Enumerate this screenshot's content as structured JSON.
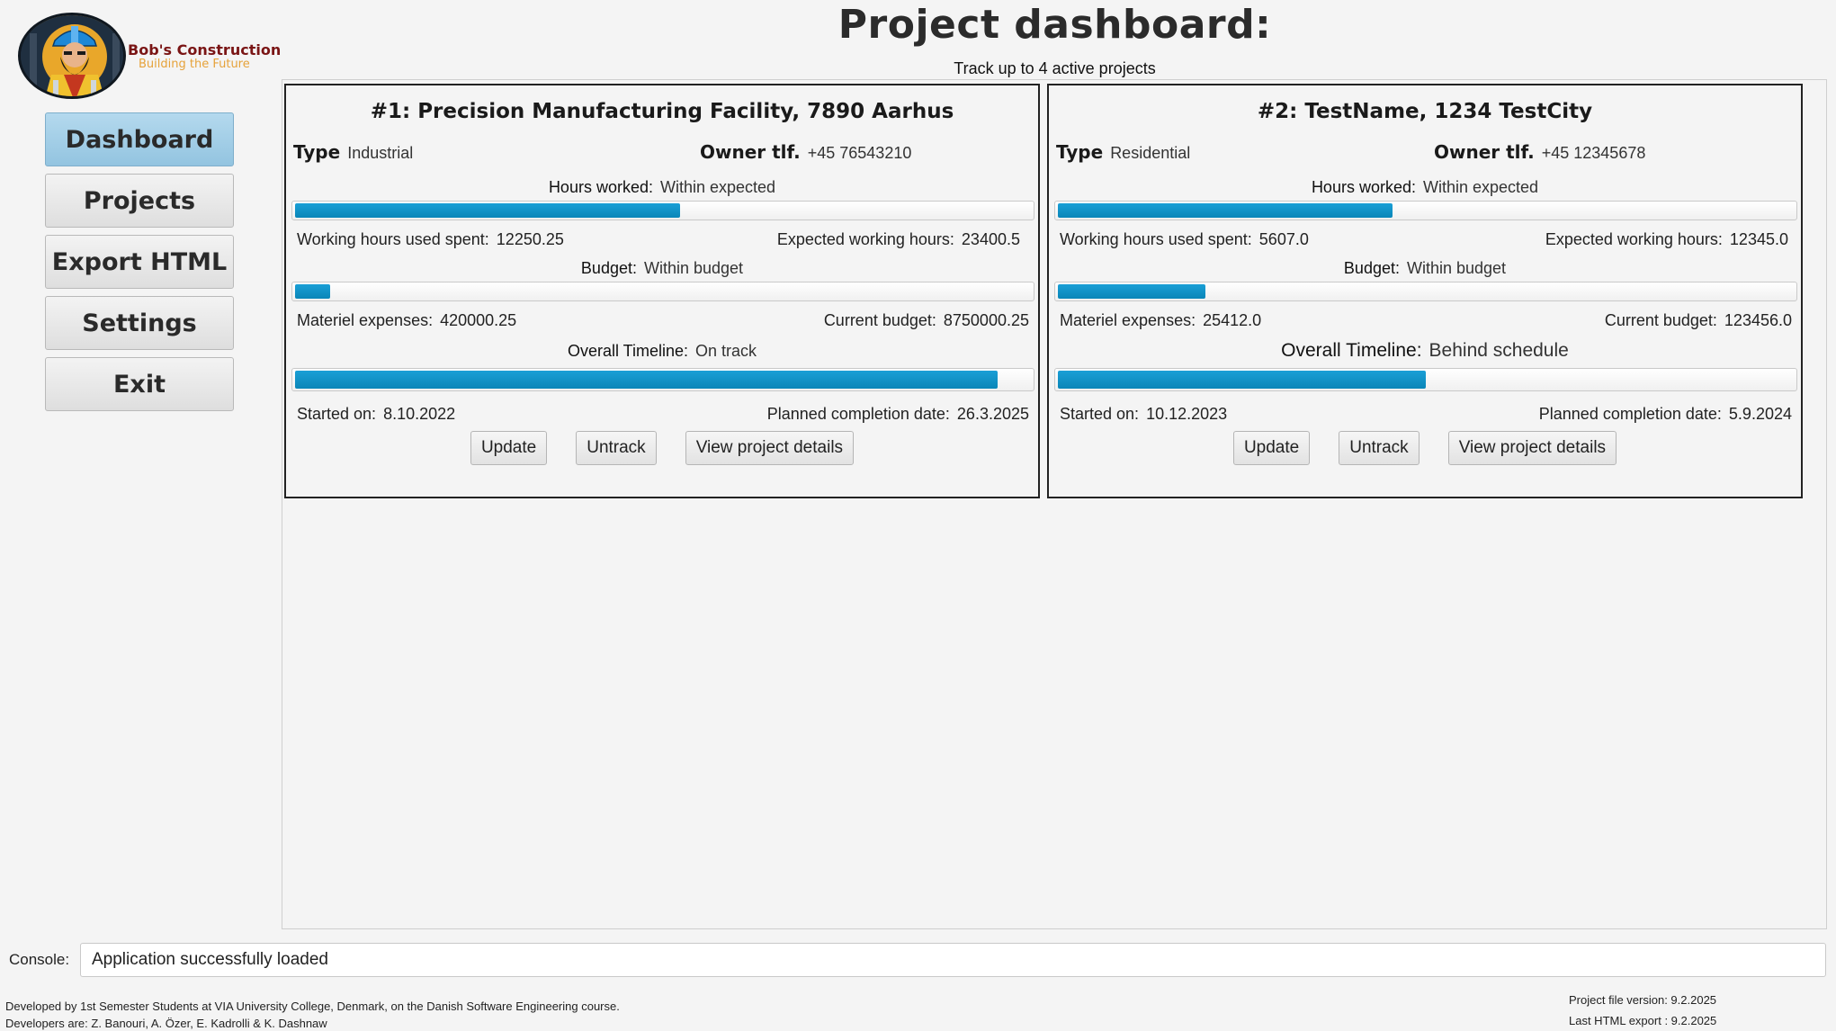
{
  "brand": {
    "name": "Bob's Construction",
    "tagline": "Building the Future",
    "colors": {
      "name": "#7a1515",
      "tagline": "#e6a23a",
      "accent": "#0a86b8"
    }
  },
  "sidebar": {
    "items": [
      {
        "label": "Dashboard",
        "active": true
      },
      {
        "label": "Projects",
        "active": false
      },
      {
        "label": "Export HTML",
        "active": false
      },
      {
        "label": "Settings",
        "active": false
      },
      {
        "label": "Exit",
        "active": false
      }
    ]
  },
  "header": {
    "title": "Project dashboard:",
    "subtitle": "Track up to 4 active projects"
  },
  "projects": [
    {
      "title": "#1: Precision Manufacturing Facility, 7890 Aarhus",
      "type_label": "Type",
      "type": "Industrial",
      "owner_label": "Owner tlf.",
      "owner_phone": "+45 76543210",
      "hours_label": "Hours worked:",
      "hours_status": "Within expected",
      "hours_progress": 0.5235,
      "hours_used_label": "Working hours used spent:",
      "hours_used": "12250.25",
      "hours_expected_label": "Expected working hours:",
      "hours_expected": "23400.5",
      "budget_label": "Budget:",
      "budget_status": "Within budget",
      "budget_progress": 0.048,
      "expenses_label": "Materiel expenses:",
      "expenses": "420000.25",
      "current_budget_label": "Current budget:",
      "current_budget": "8750000.25",
      "timeline_label": "Overall Timeline:",
      "timeline_status": "On track",
      "timeline_progress": 0.955,
      "started_label": "Started on:",
      "started": "8.10.2022",
      "planned_label": "Planned completion date:",
      "planned": "26.3.2025",
      "buttons": {
        "update": "Update",
        "untrack": "Untrack",
        "details": "View project details"
      }
    },
    {
      "title": "#2: TestName, 1234 TestCity",
      "type_label": "Type",
      "type": "Residential",
      "owner_label": "Owner tlf.",
      "owner_phone": "+45 12345678",
      "hours_label": "Hours worked:",
      "hours_status": "Within expected",
      "hours_progress": 0.4542,
      "hours_used_label": "Working hours used spent:",
      "hours_used": "5607.0",
      "hours_expected_label": "Expected working hours:",
      "hours_expected": "12345.0",
      "budget_label": "Budget:",
      "budget_status": "Within budget",
      "budget_progress": 0.2,
      "expenses_label": "Materiel expenses:",
      "expenses": "25412.0",
      "current_budget_label": "Current budget:",
      "current_budget": "123456.0",
      "timeline_label": "Overall Timeline:",
      "timeline_status": "Behind schedule",
      "timeline_progress": 0.5,
      "started_label": "Started on:",
      "started": "10.12.2023",
      "planned_label": "Planned completion date:",
      "planned": "5.9.2024",
      "buttons": {
        "update": "Update",
        "untrack": "Untrack",
        "details": "View project details"
      }
    }
  ],
  "console": {
    "label": "Console:",
    "message": "Application successfully loaded"
  },
  "footer": {
    "credits_line1": "Developed by 1st Semester Students at VIA University College, Denmark, on the Danish Software Engineering course.",
    "credits_line2": "Developers are: Z. Banouri, A. Özer, E. Kadrolli & K. Dashnaw",
    "file_version": "Project file version: 9.2.2025",
    "last_export": "Last HTML export : 9.2.2025"
  }
}
